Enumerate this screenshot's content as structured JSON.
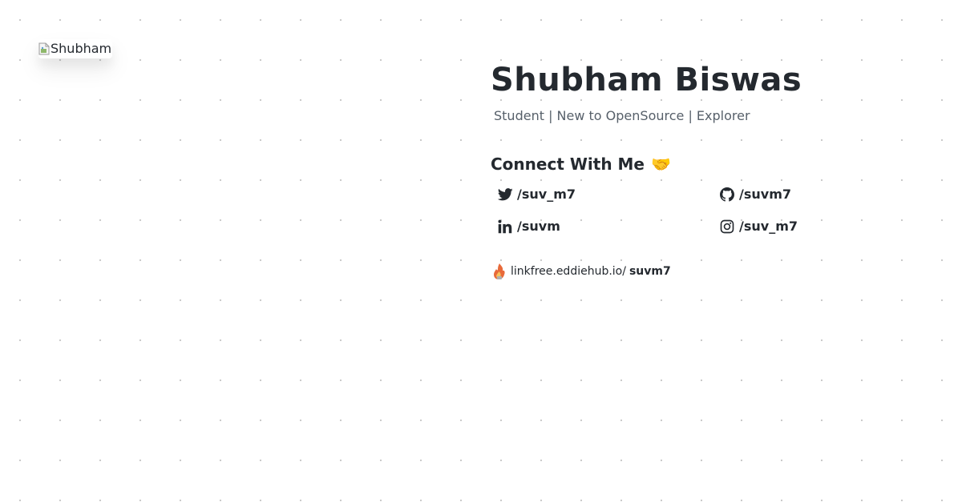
{
  "avatar": {
    "alt": "Shubham"
  },
  "profile": {
    "name": "Shubham Biswas",
    "tagline": "Student | New to OpenSource | Explorer"
  },
  "connect": {
    "heading": "Connect With Me",
    "emoji": "🤝",
    "links": {
      "twitter": {
        "label": "/suv_m7",
        "icon": "twitter-icon"
      },
      "github": {
        "label": "/suvm7",
        "icon": "github-icon"
      },
      "linkedin": {
        "label": "/suvm",
        "icon": "linkedin-icon"
      },
      "instagram": {
        "label": "/suv_m7",
        "icon": "instagram-icon"
      }
    }
  },
  "linkfree": {
    "domain": "linkfree.eddiehub.io/",
    "user": "suvm7",
    "icon": "linkfree-icon"
  },
  "colors": {
    "text": "#24292f",
    "muted": "#57606a",
    "dots": "#c8c8c8"
  }
}
